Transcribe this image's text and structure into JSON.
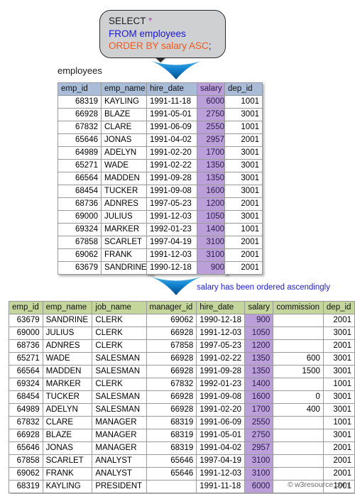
{
  "callout": {
    "line1_keyword": "SELECT",
    "line1_star": "*",
    "line2": "FROM employees",
    "line3": "ORDER BY salary ASC",
    "line3_terminator": ";",
    "colors": {
      "background": "#cfd0d2",
      "select": "#1c1c1c",
      "star": "#b23fb2",
      "from": "#1a18e0",
      "order_by": "#f4581c"
    }
  },
  "arrows": {
    "color": "#1a8fe0",
    "top_arrow_name": "down-arrow-icon",
    "bottom_arrow_name": "down-arrow-icon"
  },
  "source_table": {
    "caption": "employees",
    "header_color": "#a9bdd9",
    "highlight_color": "#bb9fd8",
    "columns": [
      "emp_id",
      "emp_name",
      "hire_date",
      "salary",
      "dep_id"
    ],
    "rows": [
      [
        "68319",
        "KAYLING",
        "1991-11-18",
        "6000",
        "1001"
      ],
      [
        "66928",
        "BLAZE",
        "1991-05-01",
        "2750",
        "3001"
      ],
      [
        "67832",
        "CLARE",
        "1991-06-09",
        "2550",
        "1001"
      ],
      [
        "65646",
        "JONAS",
        "1991-04-02",
        "2957",
        "2001"
      ],
      [
        "64989",
        "ADELYN",
        "1991-02-20",
        "1700",
        "3001"
      ],
      [
        "65271",
        "WADE",
        "1991-02-22",
        "1350",
        "3001"
      ],
      [
        "66564",
        "MADDEN",
        "1991-09-28",
        "1350",
        "3001"
      ],
      [
        "68454",
        "TUCKER",
        "1991-09-08",
        "1600",
        "3001"
      ],
      [
        "68736",
        "ADNRES",
        "1997-05-23",
        "1200",
        "2001"
      ],
      [
        "69000",
        "JULIUS",
        "1991-12-03",
        "1050",
        "3001"
      ],
      [
        "69324",
        "MARKER",
        "1992-01-23",
        "1400",
        "1001"
      ],
      [
        "67858",
        "SCARLET",
        "1997-04-19",
        "3100",
        "2001"
      ],
      [
        "69062",
        "FRANK",
        "1991-12-03",
        "3100",
        "2001"
      ],
      [
        "63679",
        "SANDRINE",
        "1990-12-18",
        "900",
        "2001"
      ]
    ]
  },
  "result_note": "salary has been ordered ascendingly",
  "result_table": {
    "header_color": "#c4d69c",
    "highlight_color": "#bb9fd8",
    "columns": [
      "emp_id",
      "emp_name",
      "job_name",
      "manager_id",
      "hire_date",
      "salary",
      "commission",
      "dep_id"
    ],
    "rows": [
      [
        "63679",
        "SANDRINE",
        "CLERK",
        "69062",
        "1990-12-18",
        "900",
        "",
        "2001"
      ],
      [
        "69000",
        "JULIUS",
        "CLERK",
        "66928",
        "1991-12-03",
        "1050",
        "",
        "3001"
      ],
      [
        "68736",
        "ADNRES",
        "CLERK",
        "67858",
        "1997-05-23",
        "1200",
        "",
        "2001"
      ],
      [
        "65271",
        "WADE",
        "SALESMAN",
        "66928",
        "1991-02-22",
        "1350",
        "600",
        "3001"
      ],
      [
        "66564",
        "MADDEN",
        "SALESMAN",
        "66928",
        "1991-09-28",
        "1350",
        "1500",
        "3001"
      ],
      [
        "69324",
        "MARKER",
        "CLERK",
        "67832",
        "1992-01-23",
        "1400",
        "",
        "1001"
      ],
      [
        "68454",
        "TUCKER",
        "SALESMAN",
        "66928",
        "1991-09-08",
        "1600",
        "0",
        "3001"
      ],
      [
        "64989",
        "ADELYN",
        "SALESMAN",
        "66928",
        "1991-02-20",
        "1700",
        "400",
        "3001"
      ],
      [
        "67832",
        "CLARE",
        "MANAGER",
        "68319",
        "1991-06-09",
        "2550",
        "",
        "1001"
      ],
      [
        "66928",
        "BLAZE",
        "MANAGER",
        "68319",
        "1991-05-01",
        "2750",
        "",
        "3001"
      ],
      [
        "65646",
        "JONAS",
        "MANAGER",
        "68319",
        "1991-04-02",
        "2957",
        "",
        "2001"
      ],
      [
        "67858",
        "SCARLET",
        "ANALYST",
        "65646",
        "1997-04-19",
        "3100",
        "",
        "2001"
      ],
      [
        "69062",
        "FRANK",
        "ANALYST",
        "65646",
        "1991-12-03",
        "3100",
        "",
        "2001"
      ],
      [
        "68319",
        "KAYLING",
        "PRESIDENT",
        "",
        "1991-11-18",
        "6000",
        "",
        "1001"
      ]
    ]
  },
  "watermark": {
    "symbol": "©",
    "text": "w3resource.com"
  }
}
